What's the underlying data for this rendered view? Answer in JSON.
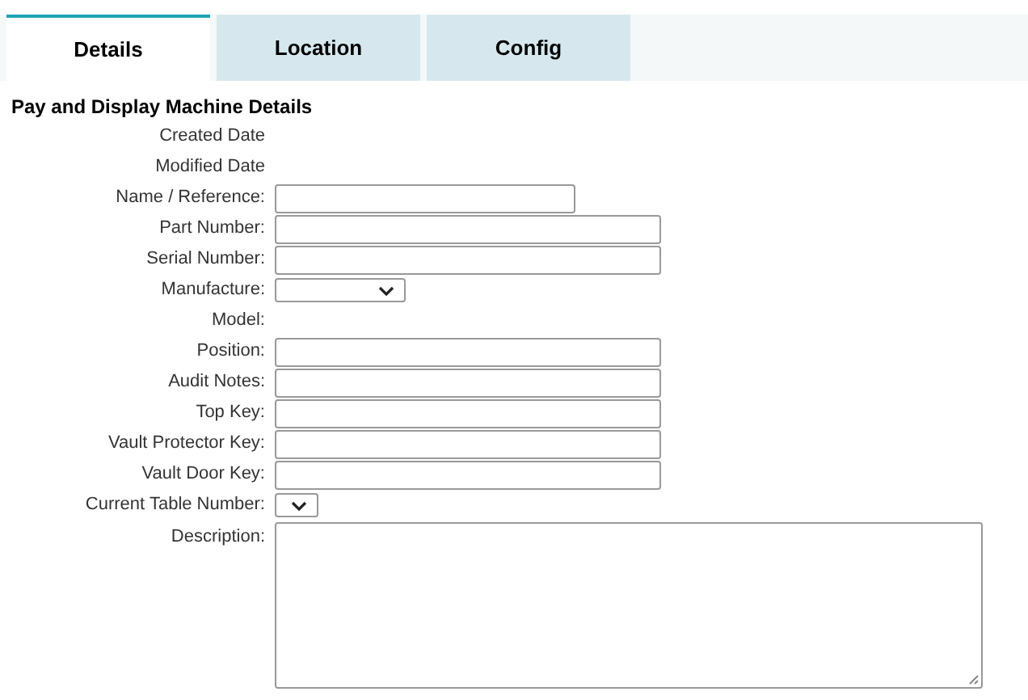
{
  "tabs": [
    {
      "label": "Details",
      "selected": true
    },
    {
      "label": "Location",
      "selected": false
    },
    {
      "label": "Config",
      "selected": false
    }
  ],
  "section_title": "Pay and Display Machine Details",
  "fields": [
    {
      "label": "Created Date",
      "kind": "info"
    },
    {
      "label": "Modified Date",
      "kind": "info"
    },
    {
      "label": "Name / Reference:",
      "kind": "short-input"
    },
    {
      "label": "Part Number:",
      "kind": "input"
    },
    {
      "label": "Serial Number:",
      "kind": "input"
    },
    {
      "label": "Manufacture:",
      "kind": "select"
    },
    {
      "label": "Model:",
      "kind": "info"
    },
    {
      "label": "Position:",
      "kind": "input"
    },
    {
      "label": "Audit Notes:",
      "kind": "input"
    },
    {
      "label": "Top Key:",
      "kind": "input"
    },
    {
      "label": "Vault Protector Key:",
      "kind": "input"
    },
    {
      "label": "Vault Door Key:",
      "kind": "input"
    },
    {
      "label": "Current Table Number:",
      "kind": "small-select"
    },
    {
      "label": "Description:",
      "kind": "textarea"
    }
  ]
}
